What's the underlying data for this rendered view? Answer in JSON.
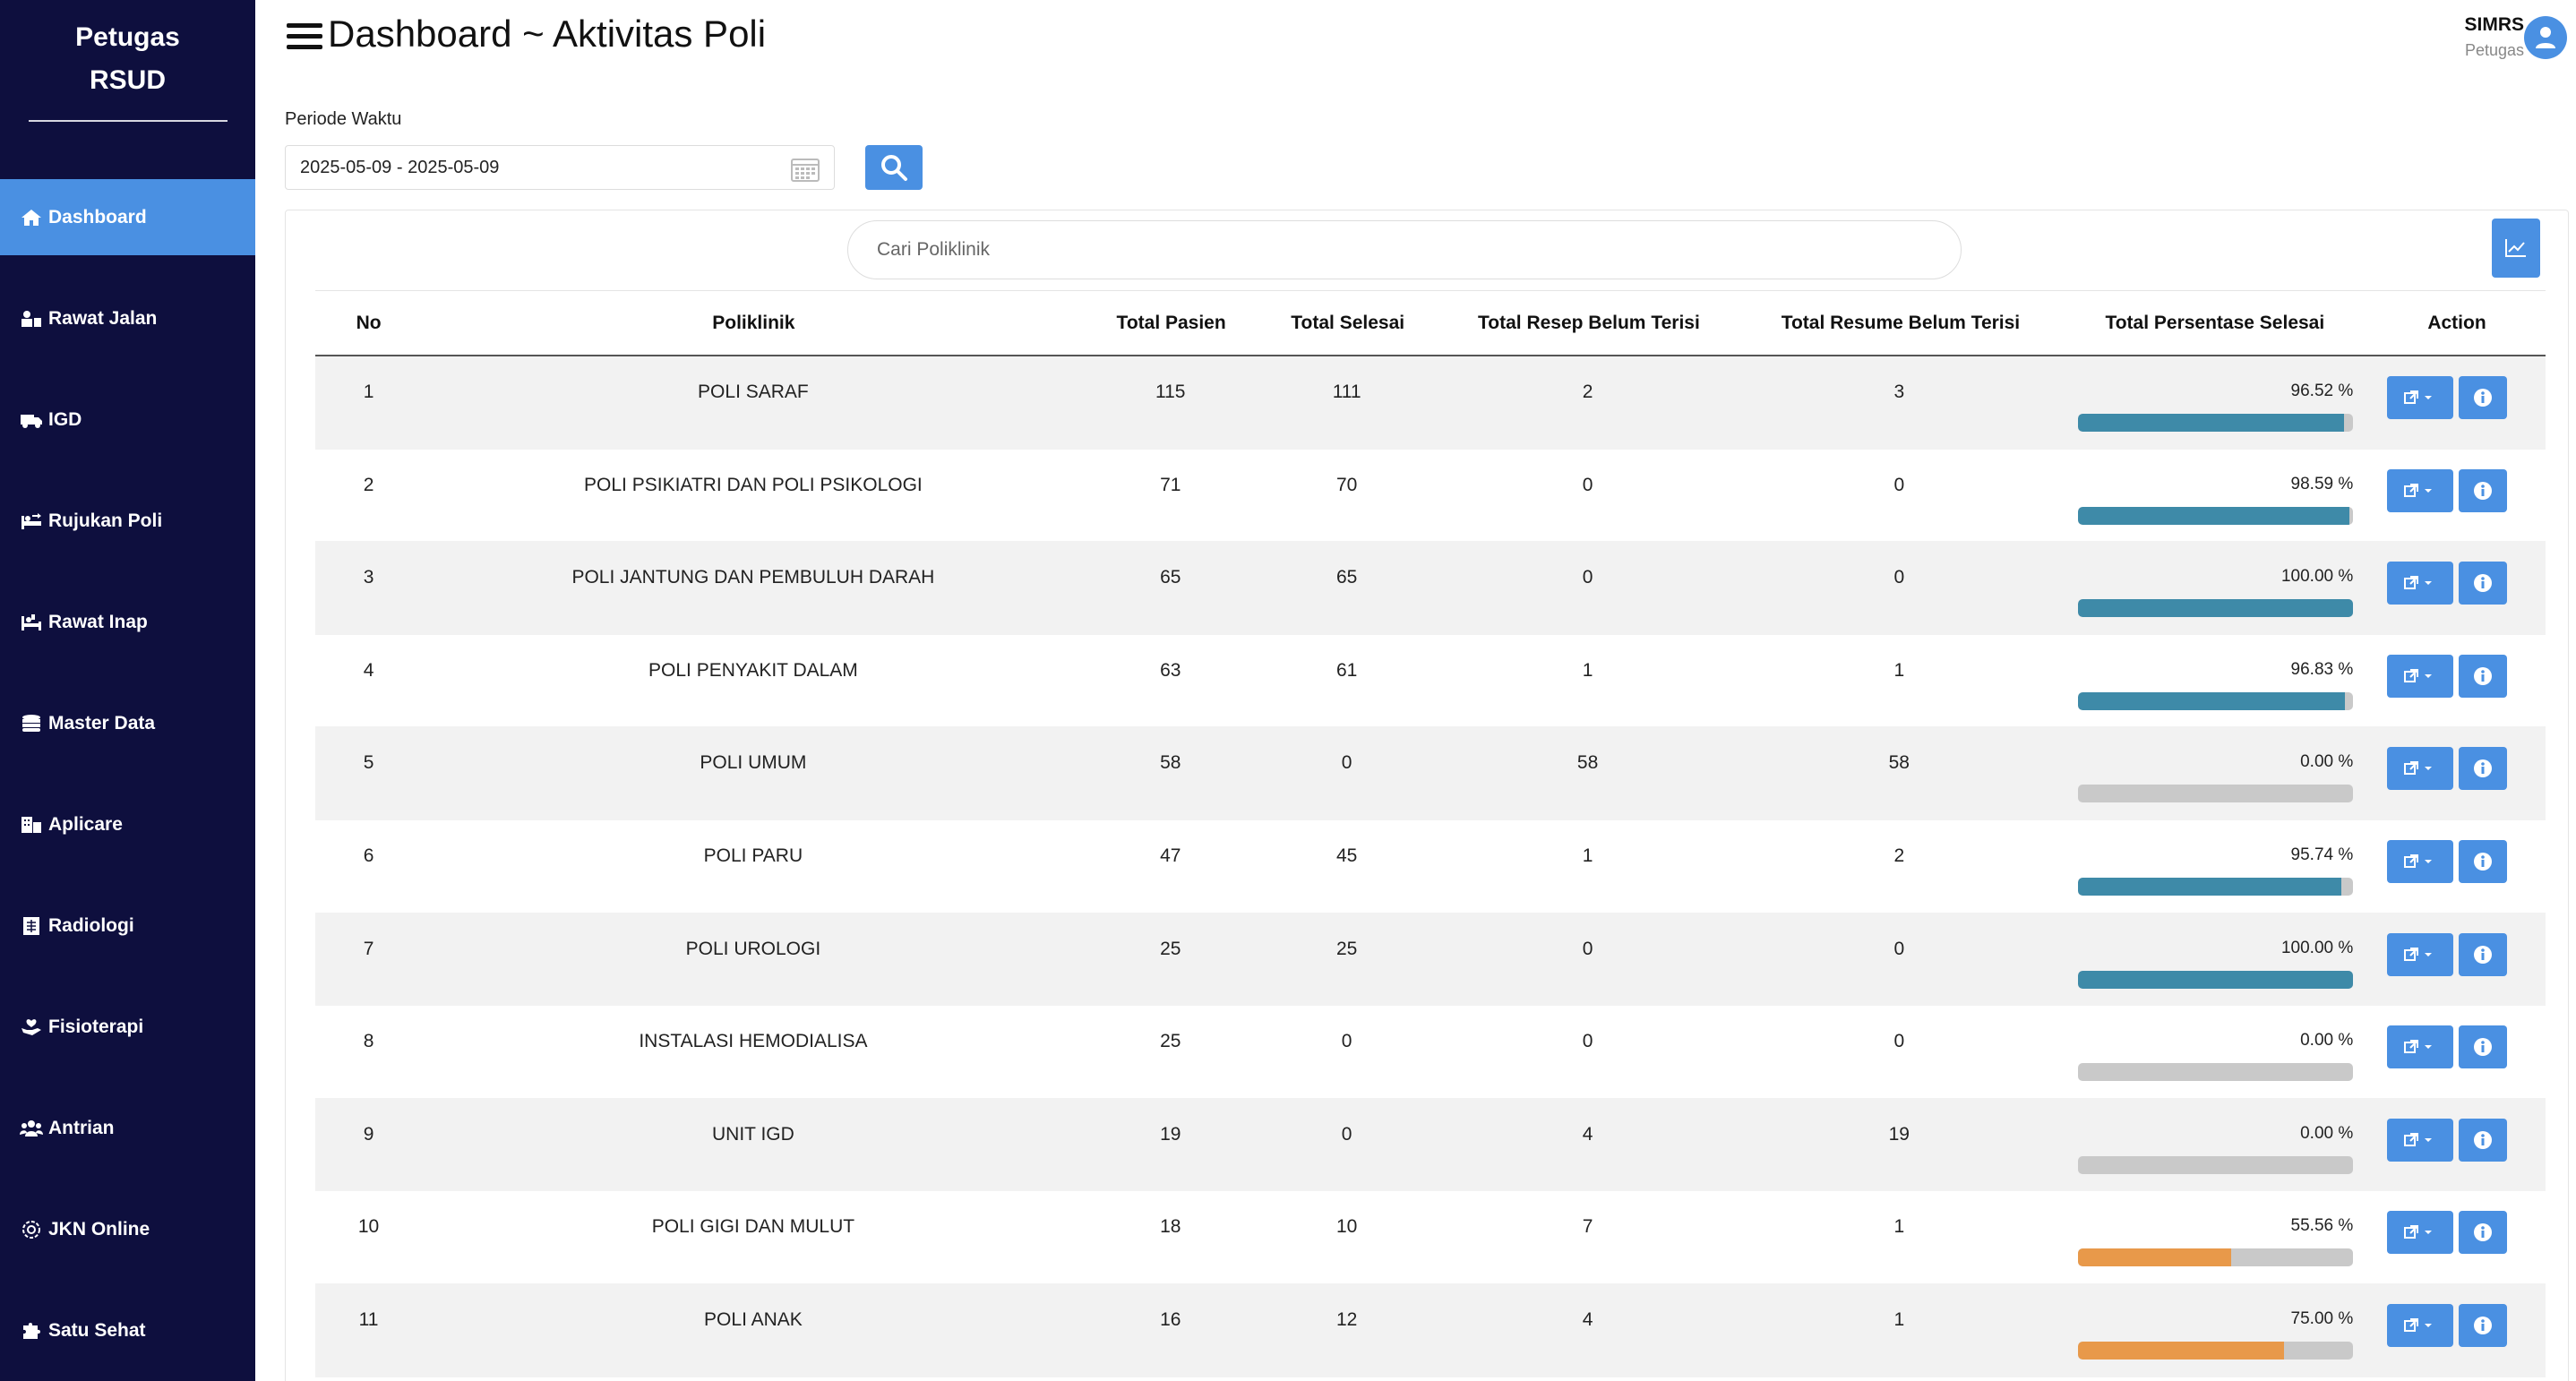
{
  "sidebar": {
    "brand_line1": "Petugas",
    "brand_line2": "RSUD",
    "items": [
      {
        "label": "Dashboard",
        "icon": "home-icon",
        "active": true
      },
      {
        "label": "Rawat Jalan",
        "icon": "user-clinic-icon"
      },
      {
        "label": "IGD",
        "icon": "ambulance-icon"
      },
      {
        "label": "Rujukan Poli",
        "icon": "bed-transfer-icon"
      },
      {
        "label": "Rawat Inap",
        "icon": "hospital-bed-icon"
      },
      {
        "label": "Master Data",
        "icon": "database-icon"
      },
      {
        "label": "Aplicare",
        "icon": "building-icon"
      },
      {
        "label": "Radiologi",
        "icon": "xray-icon"
      },
      {
        "label": "Fisioterapi",
        "icon": "hand-care-icon"
      },
      {
        "label": "Antrian",
        "icon": "users-icon"
      },
      {
        "label": "JKN Online",
        "icon": "gear-badge-icon"
      },
      {
        "label": "Satu Sehat",
        "icon": "puzzle-icon"
      }
    ]
  },
  "header": {
    "title": "Dashboard ~ Aktivitas Poli",
    "user_name": "SIMRS",
    "user_role": "Petugas"
  },
  "filter": {
    "period_label": "Periode Waktu",
    "date_range": "2025-05-09 - 2025-05-09"
  },
  "search": {
    "placeholder": "Cari Poliklinik"
  },
  "table": {
    "headers": [
      "No",
      "Poliklinik",
      "Total Pasien",
      "Total Selesai",
      "Total Resep Belum Terisi",
      "Total Resume Belum Terisi",
      "Total Persentase Selesai",
      "Action"
    ],
    "rows": [
      {
        "no": "1",
        "poli": "POLI SARAF",
        "total": "115",
        "selesai": "111",
        "resep": "2",
        "resume": "3",
        "persen": "96.52 %",
        "pct": 96.52
      },
      {
        "no": "2",
        "poli": "POLI PSIKIATRI DAN POLI PSIKOLOGI",
        "total": "71",
        "selesai": "70",
        "resep": "0",
        "resume": "0",
        "persen": "98.59 %",
        "pct": 98.59
      },
      {
        "no": "3",
        "poli": "POLI JANTUNG DAN PEMBULUH DARAH",
        "total": "65",
        "selesai": "65",
        "resep": "0",
        "resume": "0",
        "persen": "100.00 %",
        "pct": 100
      },
      {
        "no": "4",
        "poli": "POLI PENYAKIT DALAM",
        "total": "63",
        "selesai": "61",
        "resep": "1",
        "resume": "1",
        "persen": "96.83 %",
        "pct": 96.83
      },
      {
        "no": "5",
        "poli": "POLI UMUM",
        "total": "58",
        "selesai": "0",
        "resep": "58",
        "resume": "58",
        "persen": "0.00 %",
        "pct": 0
      },
      {
        "no": "6",
        "poli": "POLI PARU",
        "total": "47",
        "selesai": "45",
        "resep": "1",
        "resume": "2",
        "persen": "95.74 %",
        "pct": 95.74
      },
      {
        "no": "7",
        "poli": "POLI UROLOGI",
        "total": "25",
        "selesai": "25",
        "resep": "0",
        "resume": "0",
        "persen": "100.00 %",
        "pct": 100
      },
      {
        "no": "8",
        "poli": "INSTALASI HEMODIALISA",
        "total": "25",
        "selesai": "0",
        "resep": "0",
        "resume": "0",
        "persen": "0.00 %",
        "pct": 0
      },
      {
        "no": "9",
        "poli": "UNIT IGD",
        "total": "19",
        "selesai": "0",
        "resep": "4",
        "resume": "19",
        "persen": "0.00 %",
        "pct": 0
      },
      {
        "no": "10",
        "poli": "POLI GIGI DAN MULUT",
        "total": "18",
        "selesai": "10",
        "resep": "7",
        "resume": "1",
        "persen": "55.56 %",
        "pct": 55.56
      },
      {
        "no": "11",
        "poli": "POLI ANAK",
        "total": "16",
        "selesai": "12",
        "resep": "4",
        "resume": "1",
        "persen": "75.00 %",
        "pct": 75
      }
    ]
  },
  "colors": {
    "sidebar_bg": "#0e0f3e",
    "accent": "#4a90e2",
    "bar_high": "#3e8aa8",
    "bar_mid": "#e8994a",
    "bar_track": "#c9c9c9"
  }
}
